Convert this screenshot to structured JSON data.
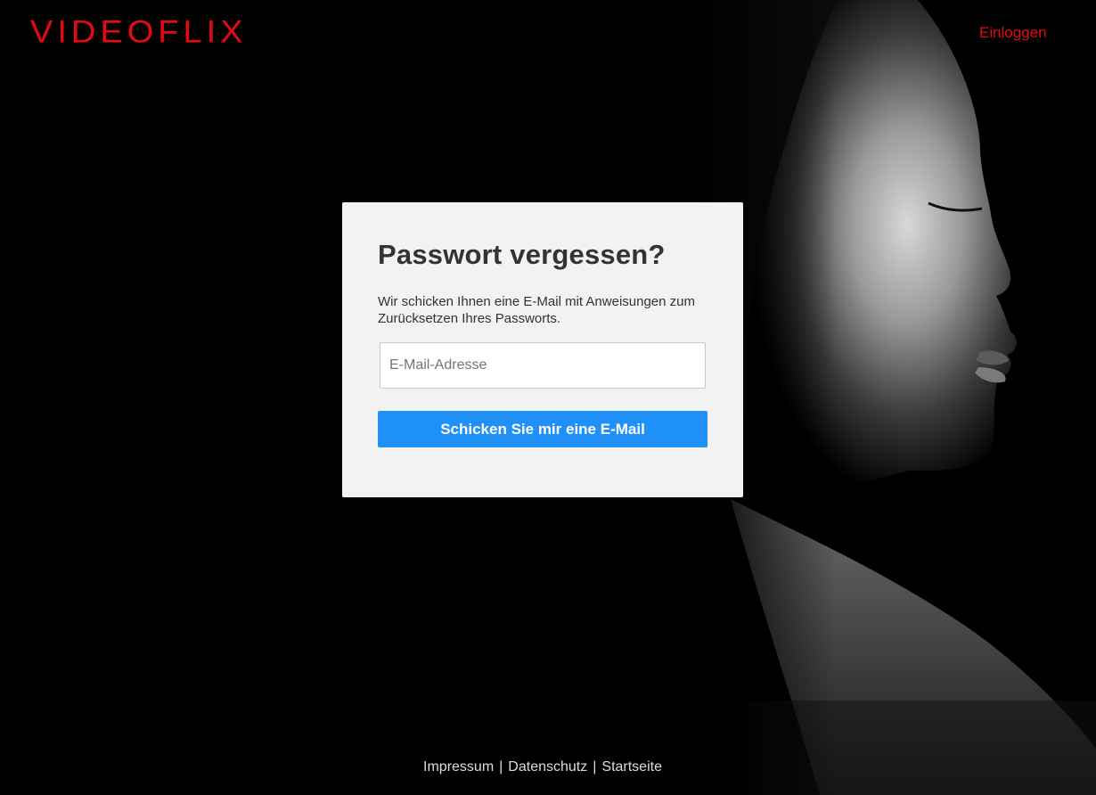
{
  "header": {
    "logo_text": "VIDEOFLIX",
    "login_label": "Einloggen"
  },
  "card": {
    "title": "Passwort vergessen?",
    "description": "Wir schicken Ihnen eine E-Mail mit Anweisungen zum Zurücksetzen Ihres Passworts.",
    "email_placeholder": "E-Mail-Adresse",
    "email_value": "",
    "submit_label": "Schicken Sie mir eine E-Mail"
  },
  "footer": {
    "links": [
      "Impressum",
      "Datenschutz",
      "Startseite"
    ],
    "separator": "|"
  },
  "colors": {
    "brand": "#e50914",
    "background": "#000000",
    "card_background": "#f2f2f2",
    "button": "#1f90f8"
  },
  "icons": {
    "hero": "woman-profile-portrait"
  }
}
